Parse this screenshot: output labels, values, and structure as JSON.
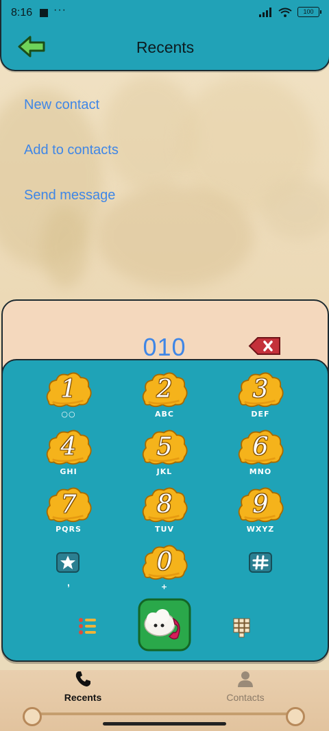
{
  "status_bar": {
    "time": "8:16",
    "dots": "···",
    "battery": "100"
  },
  "header": {
    "title": "Recents"
  },
  "menu": {
    "items": [
      {
        "label": "New contact"
      },
      {
        "label": "Add to contacts"
      },
      {
        "label": "Send message"
      }
    ]
  },
  "dialer": {
    "number": "010"
  },
  "keypad": {
    "keys": [
      {
        "digit": "1",
        "letters": "○○"
      },
      {
        "digit": "2",
        "letters": "ABC"
      },
      {
        "digit": "3",
        "letters": "DEF"
      },
      {
        "digit": "4",
        "letters": "GHI"
      },
      {
        "digit": "5",
        "letters": "JKL"
      },
      {
        "digit": "6",
        "letters": "MNO"
      },
      {
        "digit": "7",
        "letters": "PQRS"
      },
      {
        "digit": "8",
        "letters": "TUV"
      },
      {
        "digit": "9",
        "letters": "WXYZ"
      },
      {
        "digit": "0",
        "letters": "+"
      }
    ],
    "star_sub": ",",
    "accent_color": "#f5b31b",
    "panel_color": "#1fa3b7"
  },
  "bottom_nav": {
    "tabs": [
      {
        "label": "Recents"
      },
      {
        "label": "Contacts"
      }
    ]
  },
  "icons": [
    "back-arrow-icon",
    "wifi-icon",
    "signal-icon",
    "battery-icon",
    "delete-icon",
    "call-icon",
    "list-icon",
    "grid-icon",
    "phone-icon",
    "contacts-icon",
    "star-icon",
    "hash-icon",
    "voicemail-icon"
  ]
}
